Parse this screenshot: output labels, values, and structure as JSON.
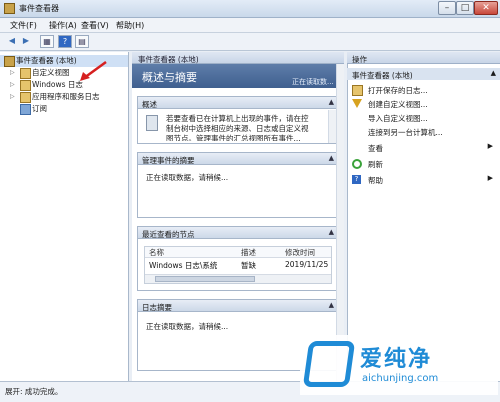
{
  "window": {
    "title": "事件查看器",
    "min": "–",
    "max": "□",
    "close": "✕"
  },
  "menu": [
    "文件(F)",
    "操作(A)",
    "查看(V)",
    "帮助(H)"
  ],
  "toolbar": [
    "◀",
    "▶",
    "▦",
    "?",
    "▤"
  ],
  "tree": {
    "root": "事件查看器 (本地)",
    "items": [
      "自定义视图",
      "Windows 日志",
      "应用程序和服务日志",
      "订阅"
    ]
  },
  "center": {
    "header": "事件查看器 (本地)",
    "banner_title": "概述与摘要",
    "banner_status": "正在读取数...",
    "sections": {
      "overview": {
        "title": "概述",
        "text1": "若要查看已在计算机上出现的事件，请在控",
        "text2": "制台树中选择相应的来源、日志或自定义视",
        "text3": "图节点。管理事件的汇总视图所有事件..."
      },
      "admin": {
        "title": "管理事件的摘要",
        "text": "正在读取数据，请稍候..."
      },
      "recent": {
        "title": "最近查看的节点",
        "columns": [
          "名称",
          "描述",
          "修改时间"
        ],
        "rows": [
          [
            "Windows 日志\\系统",
            "暂缺",
            "2019/11/25"
          ]
        ]
      },
      "logsummary": {
        "title": "日志摘要",
        "text": "正在读取数据，请稍候..."
      }
    }
  },
  "actions": {
    "header": "操作",
    "sub": "事件查看器 (本地)",
    "items": [
      {
        "label": "打开保存的日志...",
        "icon": "folder-icon"
      },
      {
        "label": "创建自定义视图...",
        "icon": "filter-icon"
      },
      {
        "label": "导入自定义视图...",
        "icon": "import-icon"
      },
      {
        "label": "连接到另一台计算机...",
        "icon": "computer-icon"
      },
      {
        "label": "查看",
        "icon": "view-icon"
      },
      {
        "label": "刷新",
        "icon": "refresh-icon"
      },
      {
        "label": "帮助",
        "icon": "help-icon"
      }
    ]
  },
  "status": "展开: 成功完成。",
  "watermark": {
    "brand": "爱纯净",
    "url": "aichunjing.com"
  },
  "colors": {
    "accent": "#1f8bd6",
    "banner": "#4a6a98"
  }
}
